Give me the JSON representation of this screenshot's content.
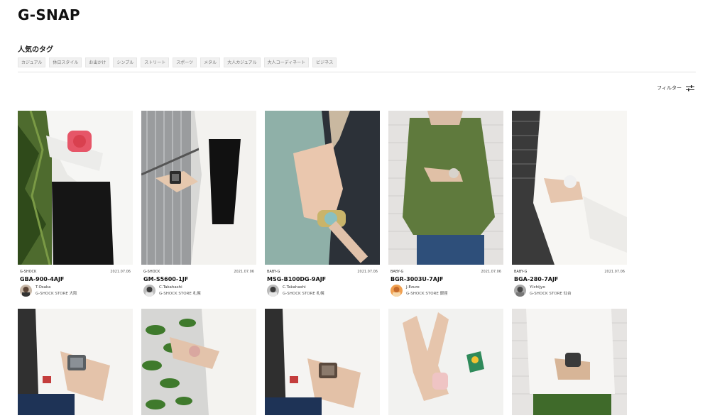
{
  "header": {
    "logo": "G-SNAP"
  },
  "tags": {
    "title": "人気のタグ",
    "items": [
      "カジュアル",
      "休日スタイル",
      "お出かけ",
      "シンプル",
      "ストリート",
      "スポーツ",
      "メタル",
      "大人カジュアル",
      "大人コーディネート",
      "ビジネス"
    ]
  },
  "filter": {
    "label": "フィルター",
    "icon": "sliders-icon"
  },
  "posts": [
    {
      "brand": "G-SHOCK",
      "date": "2021.07.06",
      "model": "GBA-900-4AJF",
      "author": "T.Osaka",
      "store": "G-SHOCK STORE 大阪"
    },
    {
      "brand": "G-SHOCK",
      "date": "2021.07.06",
      "model": "GM-S5600-1JF",
      "author": "C.Takahashi",
      "store": "G-SHOCK STORE 札幌"
    },
    {
      "brand": "BABY-G",
      "date": "2021.07.06",
      "model": "MSG-B100DG-9AJF",
      "author": "C.Takahashi",
      "store": "G-SHOCK STORE 札幌"
    },
    {
      "brand": "BABY-G",
      "date": "2021.07.06",
      "model": "BGR-3003U-7AJF",
      "author": "J.Ezure",
      "store": "G-SHOCK STORE 銀座"
    },
    {
      "brand": "BABY-G",
      "date": "2021.07.06",
      "model": "BGA-280-7AJF",
      "author": "Y.Ichijyo",
      "store": "G-SHOCK STORE 仙台"
    }
  ],
  "colors": {
    "text": "#111111",
    "tag_bg": "#f1f1f1",
    "divider": "#e3e3e3"
  }
}
